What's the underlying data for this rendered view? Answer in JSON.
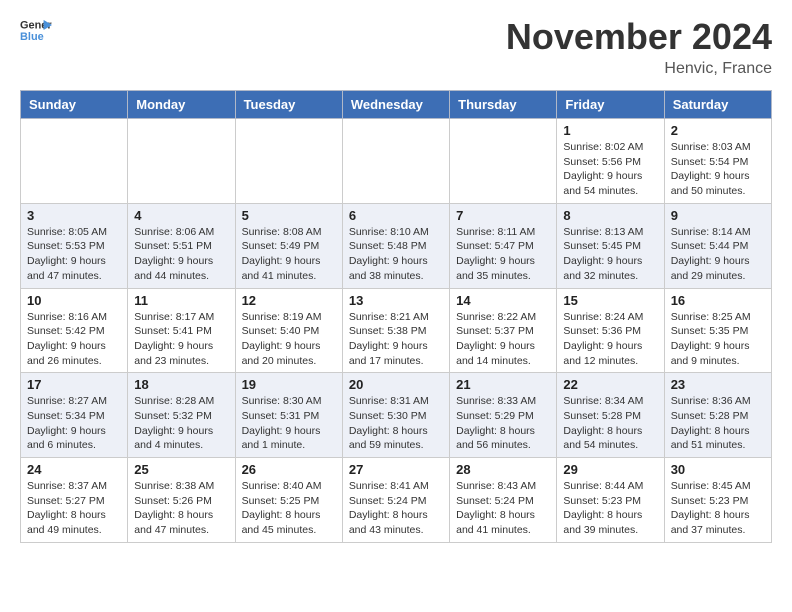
{
  "header": {
    "logo_line1": "General",
    "logo_line2": "Blue",
    "month_title": "November 2024",
    "location": "Henvic, France"
  },
  "days_of_week": [
    "Sunday",
    "Monday",
    "Tuesday",
    "Wednesday",
    "Thursday",
    "Friday",
    "Saturday"
  ],
  "weeks": [
    [
      {
        "day": "",
        "info": ""
      },
      {
        "day": "",
        "info": ""
      },
      {
        "day": "",
        "info": ""
      },
      {
        "day": "",
        "info": ""
      },
      {
        "day": "",
        "info": ""
      },
      {
        "day": "1",
        "info": "Sunrise: 8:02 AM\nSunset: 5:56 PM\nDaylight: 9 hours\nand 54 minutes."
      },
      {
        "day": "2",
        "info": "Sunrise: 8:03 AM\nSunset: 5:54 PM\nDaylight: 9 hours\nand 50 minutes."
      }
    ],
    [
      {
        "day": "3",
        "info": "Sunrise: 8:05 AM\nSunset: 5:53 PM\nDaylight: 9 hours\nand 47 minutes."
      },
      {
        "day": "4",
        "info": "Sunrise: 8:06 AM\nSunset: 5:51 PM\nDaylight: 9 hours\nand 44 minutes."
      },
      {
        "day": "5",
        "info": "Sunrise: 8:08 AM\nSunset: 5:49 PM\nDaylight: 9 hours\nand 41 minutes."
      },
      {
        "day": "6",
        "info": "Sunrise: 8:10 AM\nSunset: 5:48 PM\nDaylight: 9 hours\nand 38 minutes."
      },
      {
        "day": "7",
        "info": "Sunrise: 8:11 AM\nSunset: 5:47 PM\nDaylight: 9 hours\nand 35 minutes."
      },
      {
        "day": "8",
        "info": "Sunrise: 8:13 AM\nSunset: 5:45 PM\nDaylight: 9 hours\nand 32 minutes."
      },
      {
        "day": "9",
        "info": "Sunrise: 8:14 AM\nSunset: 5:44 PM\nDaylight: 9 hours\nand 29 minutes."
      }
    ],
    [
      {
        "day": "10",
        "info": "Sunrise: 8:16 AM\nSunset: 5:42 PM\nDaylight: 9 hours\nand 26 minutes."
      },
      {
        "day": "11",
        "info": "Sunrise: 8:17 AM\nSunset: 5:41 PM\nDaylight: 9 hours\nand 23 minutes."
      },
      {
        "day": "12",
        "info": "Sunrise: 8:19 AM\nSunset: 5:40 PM\nDaylight: 9 hours\nand 20 minutes."
      },
      {
        "day": "13",
        "info": "Sunrise: 8:21 AM\nSunset: 5:38 PM\nDaylight: 9 hours\nand 17 minutes."
      },
      {
        "day": "14",
        "info": "Sunrise: 8:22 AM\nSunset: 5:37 PM\nDaylight: 9 hours\nand 14 minutes."
      },
      {
        "day": "15",
        "info": "Sunrise: 8:24 AM\nSunset: 5:36 PM\nDaylight: 9 hours\nand 12 minutes."
      },
      {
        "day": "16",
        "info": "Sunrise: 8:25 AM\nSunset: 5:35 PM\nDaylight: 9 hours\nand 9 minutes."
      }
    ],
    [
      {
        "day": "17",
        "info": "Sunrise: 8:27 AM\nSunset: 5:34 PM\nDaylight: 9 hours\nand 6 minutes."
      },
      {
        "day": "18",
        "info": "Sunrise: 8:28 AM\nSunset: 5:32 PM\nDaylight: 9 hours\nand 4 minutes."
      },
      {
        "day": "19",
        "info": "Sunrise: 8:30 AM\nSunset: 5:31 PM\nDaylight: 9 hours\nand 1 minute."
      },
      {
        "day": "20",
        "info": "Sunrise: 8:31 AM\nSunset: 5:30 PM\nDaylight: 8 hours\nand 59 minutes."
      },
      {
        "day": "21",
        "info": "Sunrise: 8:33 AM\nSunset: 5:29 PM\nDaylight: 8 hours\nand 56 minutes."
      },
      {
        "day": "22",
        "info": "Sunrise: 8:34 AM\nSunset: 5:28 PM\nDaylight: 8 hours\nand 54 minutes."
      },
      {
        "day": "23",
        "info": "Sunrise: 8:36 AM\nSunset: 5:28 PM\nDaylight: 8 hours\nand 51 minutes."
      }
    ],
    [
      {
        "day": "24",
        "info": "Sunrise: 8:37 AM\nSunset: 5:27 PM\nDaylight: 8 hours\nand 49 minutes."
      },
      {
        "day": "25",
        "info": "Sunrise: 8:38 AM\nSunset: 5:26 PM\nDaylight: 8 hours\nand 47 minutes."
      },
      {
        "day": "26",
        "info": "Sunrise: 8:40 AM\nSunset: 5:25 PM\nDaylight: 8 hours\nand 45 minutes."
      },
      {
        "day": "27",
        "info": "Sunrise: 8:41 AM\nSunset: 5:24 PM\nDaylight: 8 hours\nand 43 minutes."
      },
      {
        "day": "28",
        "info": "Sunrise: 8:43 AM\nSunset: 5:24 PM\nDaylight: 8 hours\nand 41 minutes."
      },
      {
        "day": "29",
        "info": "Sunrise: 8:44 AM\nSunset: 5:23 PM\nDaylight: 8 hours\nand 39 minutes."
      },
      {
        "day": "30",
        "info": "Sunrise: 8:45 AM\nSunset: 5:23 PM\nDaylight: 8 hours\nand 37 minutes."
      }
    ]
  ]
}
